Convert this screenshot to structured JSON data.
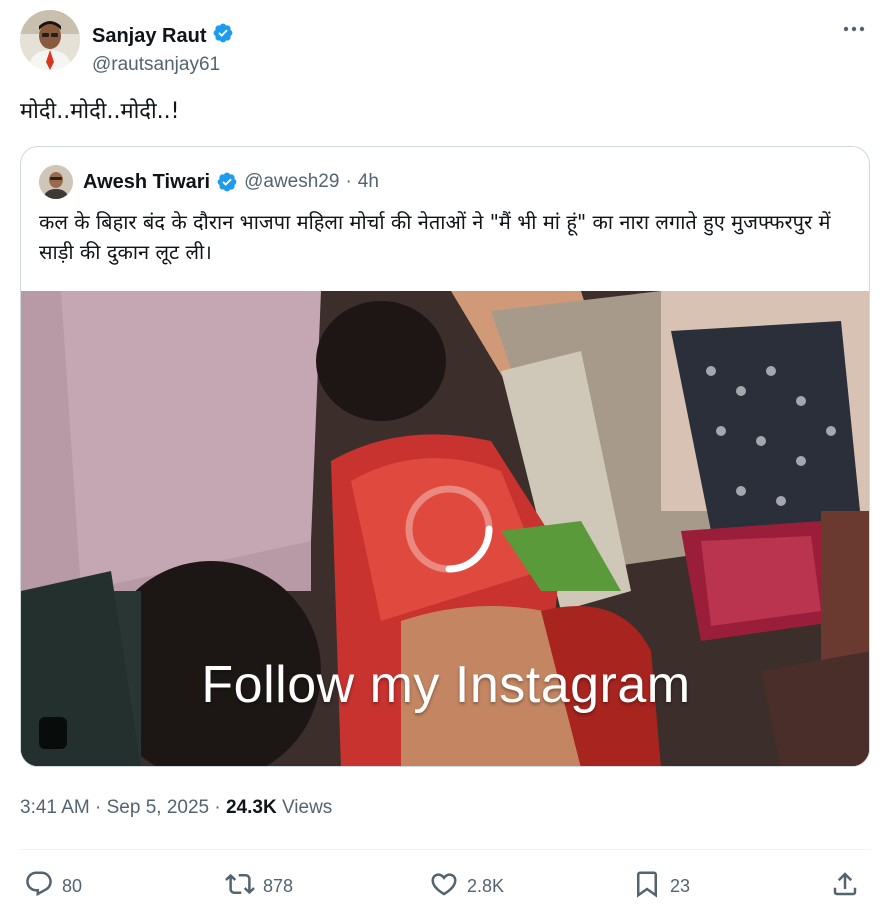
{
  "author": {
    "name": "Sanjay Raut",
    "handle": "@rautsanjay61",
    "verified": true
  },
  "tweet": {
    "text": "मोदी..मोदी..मोदी..!"
  },
  "quoted": {
    "name": "Awesh Tiwari",
    "handle": "@awesh29",
    "separator": "·",
    "time": "4h",
    "verified": true,
    "text": "कल के बिहार बंद के दौरान भाजपा महिला मोर्चा की नेताओं ने \"मैं भी मां  हूं\" का नारा लगाते हुए मुजफ्फरपुर में साड़ी की दुकान लूट ली।",
    "media": {
      "overlay_text": "Follow my Instagram",
      "loading": true
    }
  },
  "meta": {
    "time": "3:41 AM",
    "separator1": "·",
    "date": "Sep 5, 2025",
    "separator2": "·",
    "views_count": "24.3K",
    "views_label": "Views"
  },
  "actions": {
    "replies": "80",
    "reposts": "878",
    "likes": "2.8K",
    "bookmarks": "23"
  },
  "icons": {
    "verified": "verified-badge-icon",
    "more": "more-horizontal-icon",
    "reply": "reply-bubble-icon",
    "repost": "repost-arrows-icon",
    "like": "heart-icon",
    "bookmark": "bookmark-icon",
    "share": "share-upload-icon"
  },
  "colors": {
    "verified_blue": "#1d9bf0",
    "secondary_text": "#536471",
    "primary_text": "#0f1419",
    "border": "#cfd9de"
  }
}
